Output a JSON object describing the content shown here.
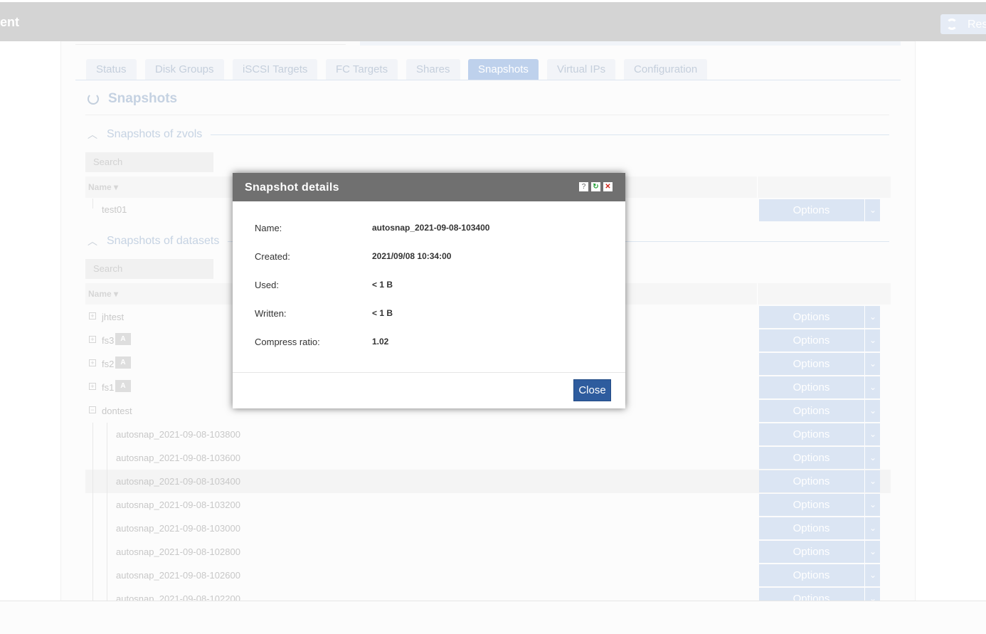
{
  "app": {
    "title_fragment": "ent",
    "reset_label": "Res"
  },
  "tabs": [
    "Status",
    "Disk Groups",
    "iSCSI Targets",
    "FC Targets",
    "Shares",
    "Snapshots",
    "Virtual IPs",
    "Configuration"
  ],
  "active_tab": "Snapshots",
  "section_title": "Snapshots",
  "zvols": {
    "title": "Snapshots of zvols",
    "search_placeholder": "Search",
    "name_header": "Name ▾",
    "rows": [
      {
        "name": "test01",
        "options": "Options"
      }
    ]
  },
  "datasets": {
    "title": "Snapshots of datasets",
    "search_placeholder": "Search",
    "name_header": "Name ▾",
    "rows": [
      {
        "name": "jhtest",
        "options": "Options"
      },
      {
        "name": "fs3",
        "badge": "A",
        "options": "Options"
      },
      {
        "name": "fs2",
        "badge": "A",
        "options": "Options"
      },
      {
        "name": "fs1",
        "badge": "A",
        "options": "Options"
      },
      {
        "name": "dontest",
        "options": "Options"
      },
      {
        "name": "autosnap_2021-09-08-103800",
        "options": "Options"
      },
      {
        "name": "autosnap_2021-09-08-103600",
        "options": "Options"
      },
      {
        "name": "autosnap_2021-09-08-103400",
        "options": "Options"
      },
      {
        "name": "autosnap_2021-09-08-103200",
        "options": "Options"
      },
      {
        "name": "autosnap_2021-09-08-103000",
        "options": "Options"
      },
      {
        "name": "autosnap_2021-09-08-102800",
        "options": "Options"
      },
      {
        "name": "autosnap_2021-09-08-102600",
        "options": "Options"
      },
      {
        "name": "autosnap_2021-09-08-102200",
        "options": "Options"
      }
    ]
  },
  "modal": {
    "title": "Snapshot details",
    "help_icon": "?",
    "refresh_icon": "↻",
    "close_icon": "✕",
    "fields": [
      {
        "label": "Name:",
        "value": "autosnap_2021-09-08-103400"
      },
      {
        "label": "Created:",
        "value": "2021/09/08 10:34:00"
      },
      {
        "label": "Used:",
        "value": "< 1 B"
      },
      {
        "label": "Written:",
        "value": "< 1 B"
      },
      {
        "label": "Compress ratio:",
        "value": "1.02"
      }
    ],
    "close_label": "Close"
  },
  "colors": {
    "modal_header": "#707070",
    "primary_button": "#2e5c9e",
    "active_tab": "#bed1ec"
  }
}
